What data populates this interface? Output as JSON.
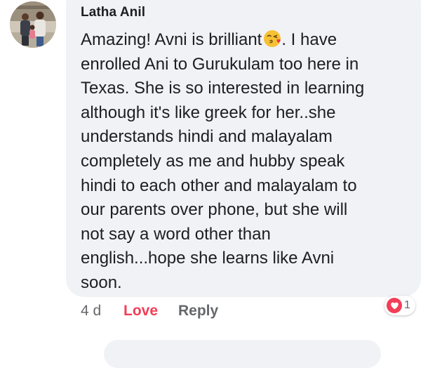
{
  "comment": {
    "author": "Latha Anil",
    "text_lines": [
      "Amazing! Avni is brilliant",
      ". I have",
      "enrolled Ani to Gurukulam too here in",
      "Texas. She is so interested in learning",
      "although it's like greek for her..she",
      "understands hindi and malayalam",
      "completely as me and hubby speak",
      "hindi to each other and malayalam to",
      "our parents over phone, but she will",
      "not say a word other than",
      "english...hope she learns like Avni",
      "soon."
    ],
    "emoji": "face-blowing-a-kiss-icon"
  },
  "actions": {
    "timestamp": "4 d",
    "love_label": "Love",
    "reply_label": "Reply"
  },
  "reactions": {
    "icon": "heart-reaction-icon",
    "count": "1"
  },
  "colors": {
    "bubble_bg": "#f0f2f5",
    "text": "#1c1e21",
    "meta_text": "#65676b",
    "love_red": "#f33e58"
  }
}
